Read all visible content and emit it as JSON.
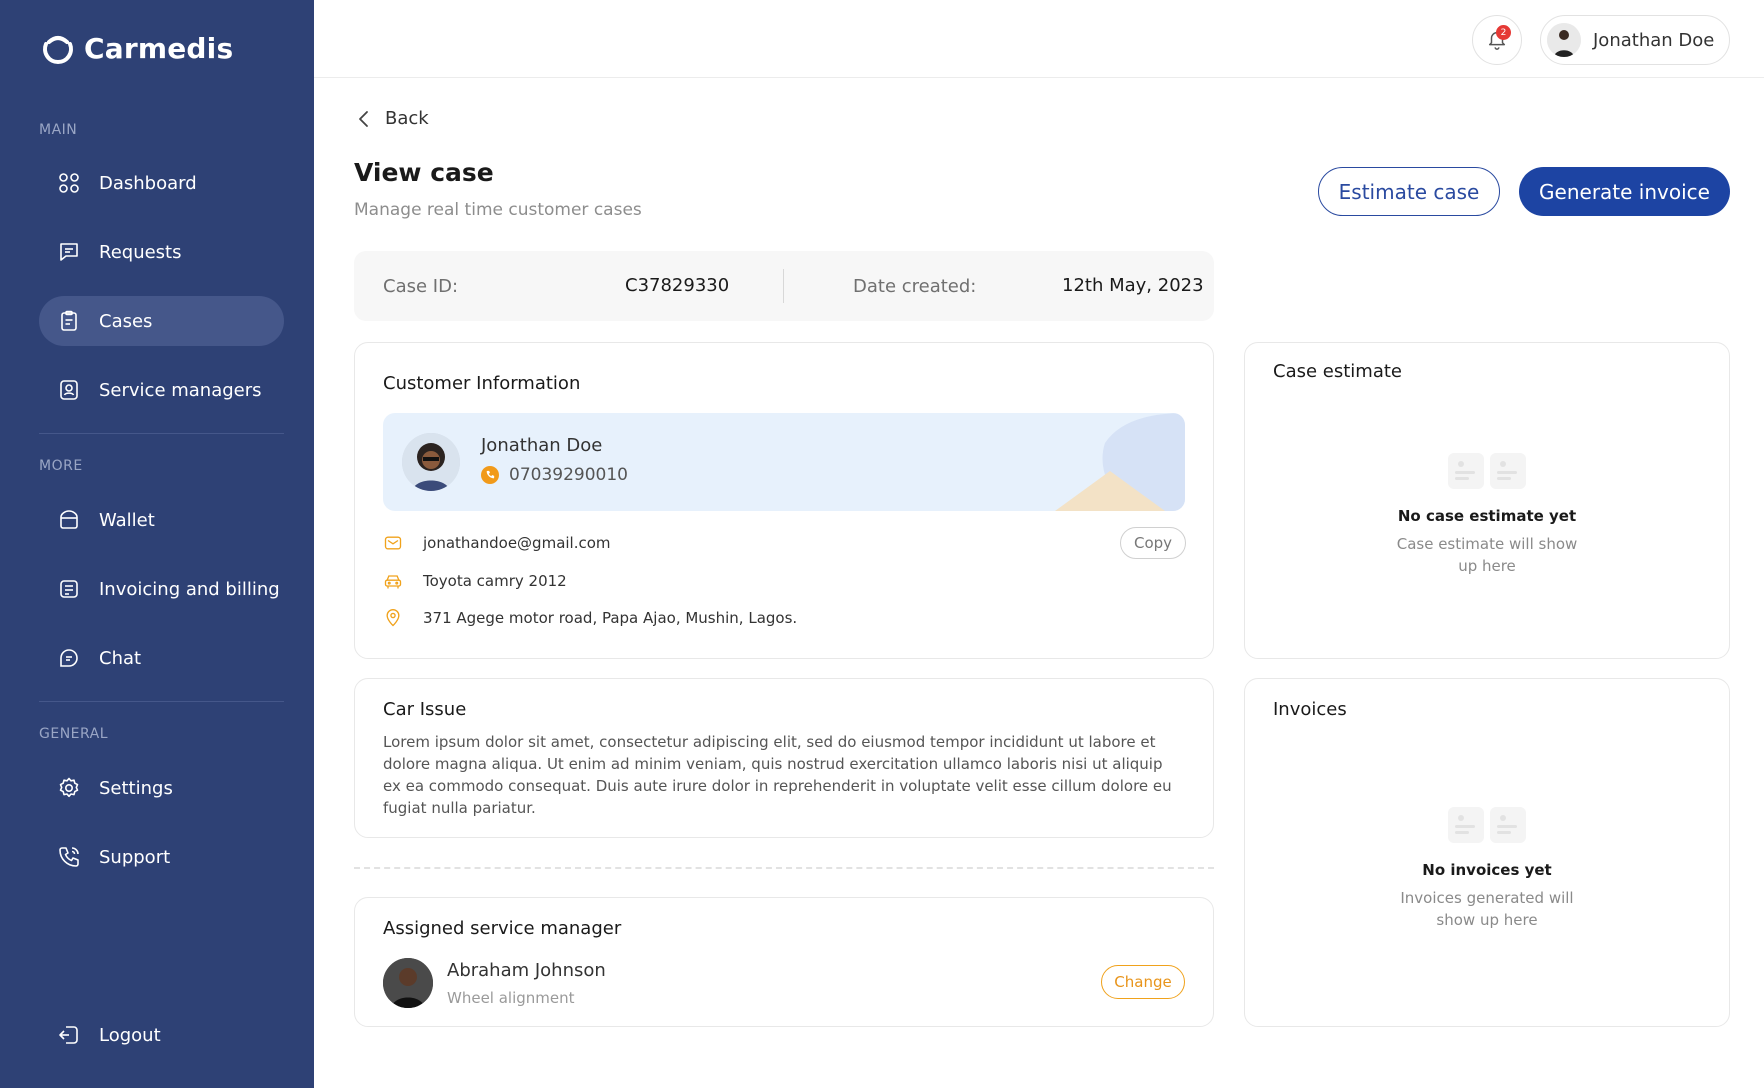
{
  "brand": {
    "name": "Carmedis"
  },
  "sidebar": {
    "sections": {
      "main": "MAIN",
      "more": "MORE",
      "general": "GENERAL"
    },
    "items": [
      {
        "label": "Dashboard",
        "icon": "grid-icon"
      },
      {
        "label": "Requests",
        "icon": "message-icon"
      },
      {
        "label": "Cases",
        "icon": "clipboard-icon",
        "active": true
      },
      {
        "label": "Service managers",
        "icon": "badge-icon"
      },
      {
        "label": "Wallet",
        "icon": "wallet-icon"
      },
      {
        "label": "Invoicing and billing",
        "icon": "invoice-icon"
      },
      {
        "label": "Chat",
        "icon": "chat-icon"
      },
      {
        "label": "Settings",
        "icon": "gear-icon"
      },
      {
        "label": "Support",
        "icon": "phone-icon"
      }
    ],
    "logout": "Logout"
  },
  "topbar": {
    "notifications_count": "2",
    "user_name": "Jonathan Doe"
  },
  "page": {
    "back": "Back",
    "title": "View case",
    "subtitle": "Manage real time customer cases",
    "estimate_button": "Estimate case",
    "invoice_button": "Generate invoice"
  },
  "case": {
    "id_label": "Case ID:",
    "id_value": "C37829330",
    "date_label": "Date created:",
    "date_value": "12th May, 2023"
  },
  "customer": {
    "section_title": "Customer Information",
    "name": "Jonathan Doe",
    "phone": "07039290010",
    "email": "jonathandoe@gmail.com",
    "copy_label": "Copy",
    "car": "Toyota camry 2012",
    "address": "371 Agege motor road, Papa Ajao, Mushin, Lagos."
  },
  "car_issue": {
    "title": "Car Issue",
    "text": "Lorem ipsum dolor sit amet, consectetur adipiscing elit, sed do eiusmod tempor incididunt ut labore et dolore magna aliqua. Ut enim ad minim veniam, quis nostrud exercitation ullamco laboris nisi ut aliquip ex ea commodo consequat. Duis aute irure dolor in reprehenderit in voluptate velit esse cillum dolore eu fugiat nulla pariatur."
  },
  "manager": {
    "title": "Assigned service manager",
    "name": "Abraham Johnson",
    "role": "Wheel alignment",
    "change_label": "Change"
  },
  "estimate_panel": {
    "title": "Case estimate",
    "empty_title": "No case estimate yet",
    "empty_sub": "Case estimate will show up here"
  },
  "invoices_panel": {
    "title": "Invoices",
    "empty_title": "No invoices yet",
    "empty_sub": "Invoices generated will show up here"
  },
  "colors": {
    "sidebar_bg": "#2e4175",
    "primary": "#1d44a3",
    "accent_orange": "#f19a1a",
    "banner_bg": "#e7f1fc"
  }
}
